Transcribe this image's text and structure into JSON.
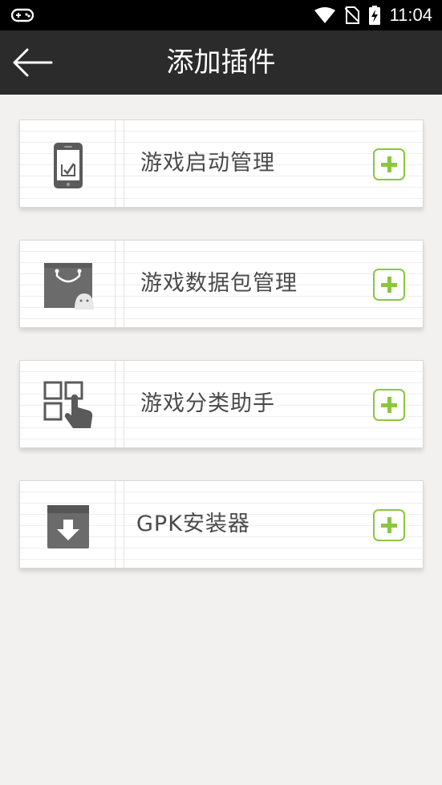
{
  "status_bar": {
    "time": "11:04"
  },
  "header": {
    "title": "添加插件"
  },
  "plugins": [
    {
      "label": "游戏启动管理",
      "icon": "phone-check-icon"
    },
    {
      "label": "游戏数据包管理",
      "icon": "shopping-bag-android-icon"
    },
    {
      "label": "游戏分类助手",
      "icon": "grid-hand-icon"
    },
    {
      "label": "GPK安装器",
      "icon": "archive-download-icon"
    }
  ],
  "colors": {
    "accent": "#8cc63f",
    "topbar": "#2b2b2b",
    "background": "#f2f1ef",
    "text": "#4a4a4a"
  }
}
